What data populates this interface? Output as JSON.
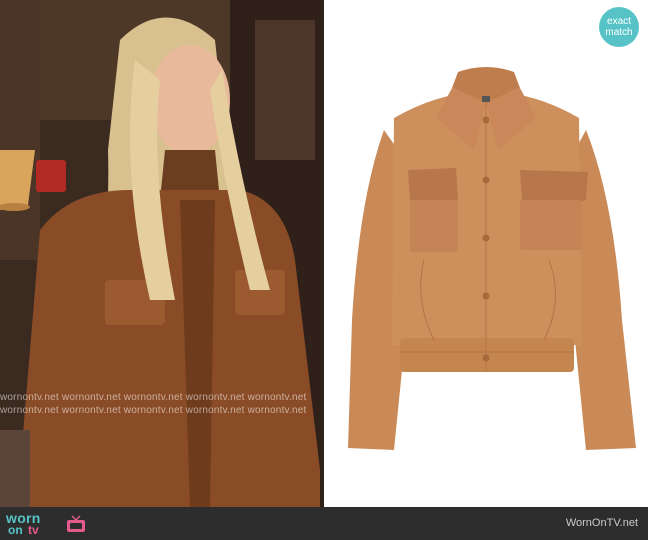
{
  "badge": {
    "line1": "exact",
    "line2": "match"
  },
  "watermark": {
    "row1": "wornontv.net   wornontv.net   wornontv.net   wornontv.net   wornontv.net",
    "row2": "wornontv.net   wornontv.net   wornontv.net   wornontv.net   wornontv.net"
  },
  "footer": {
    "logo_worn": "worn",
    "logo_on": "on",
    "logo_tv": "tv",
    "site_name": "WornOnTV.net"
  },
  "colors": {
    "badge": "#57c3c6",
    "footer": "#2d2d2d",
    "jacket": "#c98a58",
    "leather": "#c48455",
    "collar": "#c9875a",
    "worn_logo": "#57c3c6",
    "tv_logo": "#e35a8c"
  }
}
